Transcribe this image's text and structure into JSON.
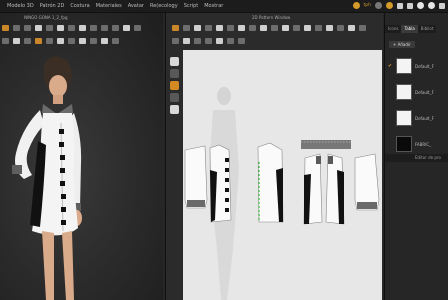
{
  "menu": {
    "items": [
      "Modelo 3D",
      "Patrón 2D",
      "Costura",
      "Materiales",
      "Avatar",
      "Re(ecology",
      "Script",
      "Mostrar"
    ],
    "status_text": "tph"
  },
  "viewport3d": {
    "title": "NINGO GONA 1_2_fpg"
  },
  "pattern2d": {
    "title": "2D Pattern Window"
  },
  "right_panel": {
    "tabs": [
      "Icons",
      "Tabla",
      "Bibliot"
    ],
    "add_label": "+ Añadir",
    "fabrics": [
      {
        "name": "Default_F",
        "color": "#f4f4f4",
        "checked": true
      },
      {
        "name": "Default_F",
        "color": "#f4f4f4",
        "checked": false
      },
      {
        "name": "Default_F",
        "color": "#f4f4f4",
        "checked": false
      },
      {
        "name": "FABRIC_",
        "color": "#0a0a0a",
        "checked": false
      }
    ],
    "property_editor": "Editor de pro"
  }
}
